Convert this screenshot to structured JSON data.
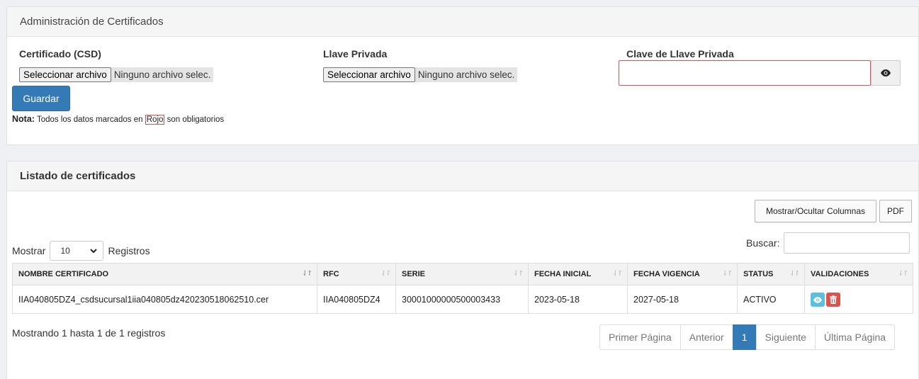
{
  "admin_panel": {
    "title": "Administración de Certificados",
    "certificado_label": "Certificado (CSD)",
    "llave_label": "Llave Privada",
    "clave_label": "Clave de Llave Privada",
    "file_button_label": "Seleccionar archivo",
    "file_none_text": "Ninguno archivo selec.",
    "save_label": "Guardar",
    "note_bold": "Nota:",
    "note_text_1": "Todos los datos marcados en",
    "note_rojo": "Rojo",
    "note_text_2": "son obligatorios",
    "required_color": "#d9534f"
  },
  "list_panel": {
    "title": "Listado de certificados",
    "toggle_columns_label": "Mostrar/Ocultar Columnas",
    "pdf_label": "PDF",
    "show_label": "Mostrar",
    "page_length": "10",
    "records_label": "Registros",
    "search_label": "Buscar:",
    "search_value": "",
    "columns": [
      "NOMBRE CERTIFICADO",
      "RFC",
      "SERIE",
      "FECHA INICIAL",
      "FECHA VIGENCIA",
      "STATUS",
      "VALIDACIONES"
    ],
    "rows": [
      {
        "nombre": "IIA040805DZ4_csdsucursal1iia040805dz420230518062510.cer",
        "rfc": "IIA040805DZ4",
        "serie": "30001000000500003433",
        "fecha_inicial": "2023-05-18",
        "fecha_vigencia": "2027-05-18",
        "status": "ACTIVO",
        "actions": [
          "eye-icon",
          "trash-icon"
        ]
      }
    ],
    "info_text": "Mostrando 1 hasta 1 de 1 registros",
    "pagination": {
      "first": "Primer Página",
      "prev": "Anterior",
      "current": "1",
      "next": "Siguiente",
      "last": "Última Página"
    },
    "accent_color": "#337ab7"
  }
}
